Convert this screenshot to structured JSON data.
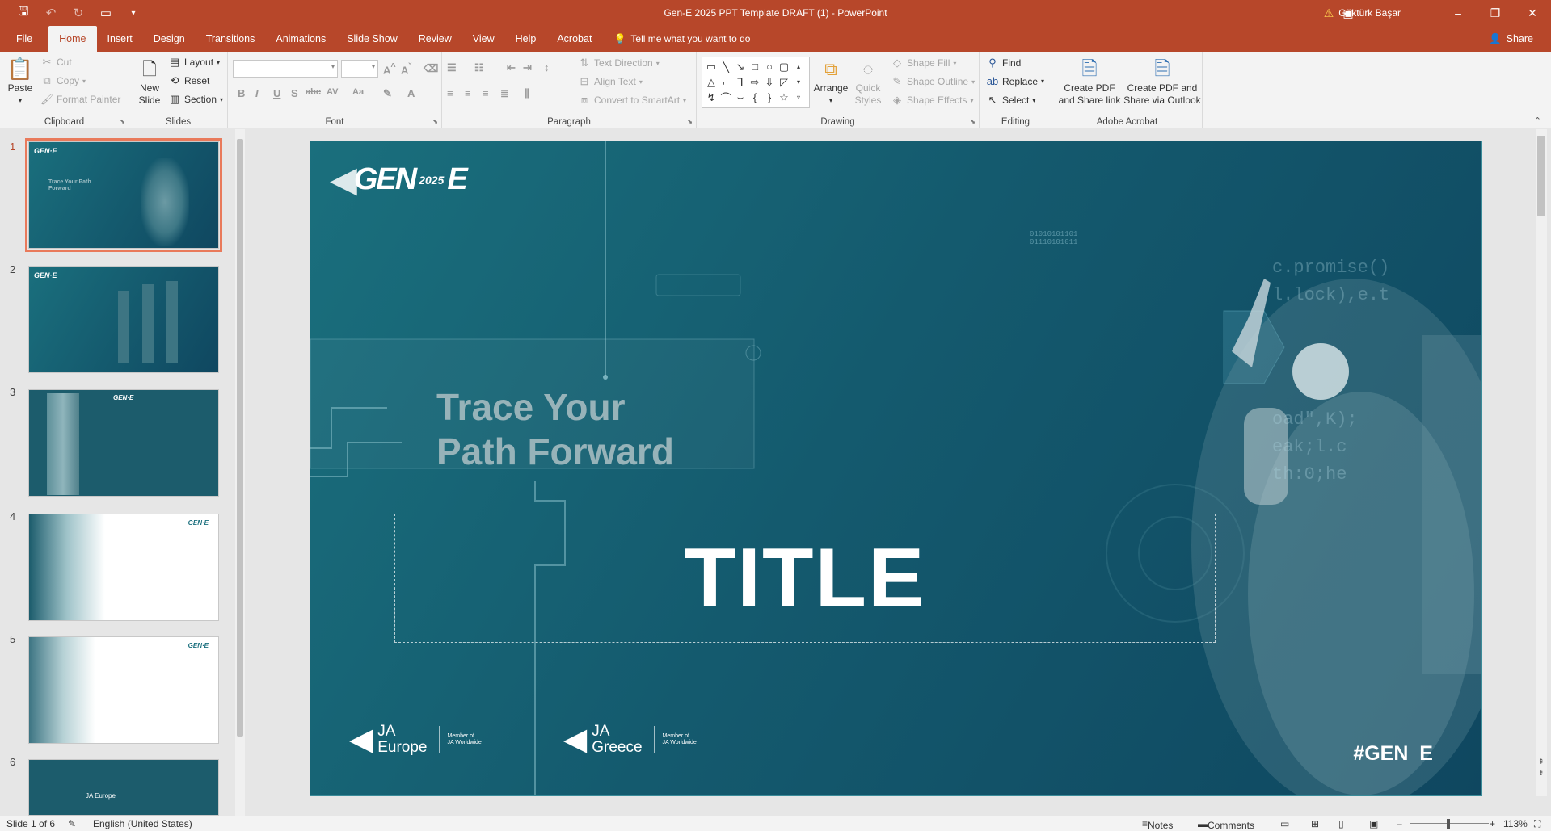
{
  "window": {
    "title": "Gen-E 2025 PPT Template DRAFT (1)  -  PowerPoint",
    "user": "Göktürk Başar",
    "minimize": "–",
    "restore": "❐",
    "close": "✕"
  },
  "tabs": [
    "File",
    "Home",
    "Insert",
    "Design",
    "Transitions",
    "Animations",
    "Slide Show",
    "Review",
    "View",
    "Help",
    "Acrobat"
  ],
  "tell_me": "Tell me what you want to do",
  "share_label": "Share",
  "ribbon": {
    "clipboard": {
      "label": "Clipboard",
      "paste": "Paste",
      "cut": "Cut",
      "copy": "Copy",
      "format_painter": "Format Painter"
    },
    "slides": {
      "label": "Slides",
      "new_slide": "New Slide",
      "layout": "Layout",
      "reset": "Reset",
      "section": "Section"
    },
    "font": {
      "label": "Font",
      "font_name": "",
      "font_size": ""
    },
    "paragraph": {
      "label": "Paragraph",
      "text_direction": "Text Direction",
      "align_text": "Align Text",
      "convert_smartart": "Convert to SmartArt"
    },
    "drawing": {
      "label": "Drawing",
      "arrange": "Arrange",
      "quick_styles": "Quick Styles",
      "shape_fill": "Shape Fill",
      "shape_outline": "Shape Outline",
      "shape_effects": "Shape Effects"
    },
    "editing": {
      "label": "Editing",
      "find": "Find",
      "replace": "Replace",
      "select": "Select"
    },
    "acrobat": {
      "label": "Adobe Acrobat",
      "create_pdf_link": "Create PDF and Share link",
      "create_pdf_outlook": "Create PDF and Share via Outlook"
    }
  },
  "thumbnails": [
    {
      "num": "1",
      "title": "Trace Your Path Forward",
      "selected": true
    },
    {
      "num": "2",
      "selected": false
    },
    {
      "num": "3",
      "selected": false
    },
    {
      "num": "4",
      "selected": false
    },
    {
      "num": "5",
      "selected": false
    },
    {
      "num": "6",
      "selected": false
    }
  ],
  "slide": {
    "logo_main": "GEN",
    "logo_year": "2025",
    "logo_e": "E",
    "heading_line1": "Trace Your",
    "heading_line2": "Path Forward",
    "title_placeholder": "TITLE",
    "ja_europe_top": "JA",
    "ja_europe_bottom": "Europe",
    "ja_greece_top": "JA",
    "ja_greece_bottom": "Greece",
    "member_line1": "Member of",
    "member_line2": "JA Worldwide",
    "hashtag": "#GEN_E",
    "binary1": "01010101101",
    "binary2": "01110101011",
    "code1": "c.promise()",
    "code2": "l.lock),e.t",
    "code3": "oad\",K);",
    "code4": "eak;l.c",
    "code5": "th:0;he"
  },
  "status": {
    "slide_of": "Slide 1 of 6",
    "language": "English (United States)",
    "notes": "Notes",
    "comments": "Comments",
    "zoom": "113%"
  },
  "colors": {
    "accent": "#b7472a",
    "slide_bg": "#145a6e",
    "selection": "#e97a5b"
  }
}
